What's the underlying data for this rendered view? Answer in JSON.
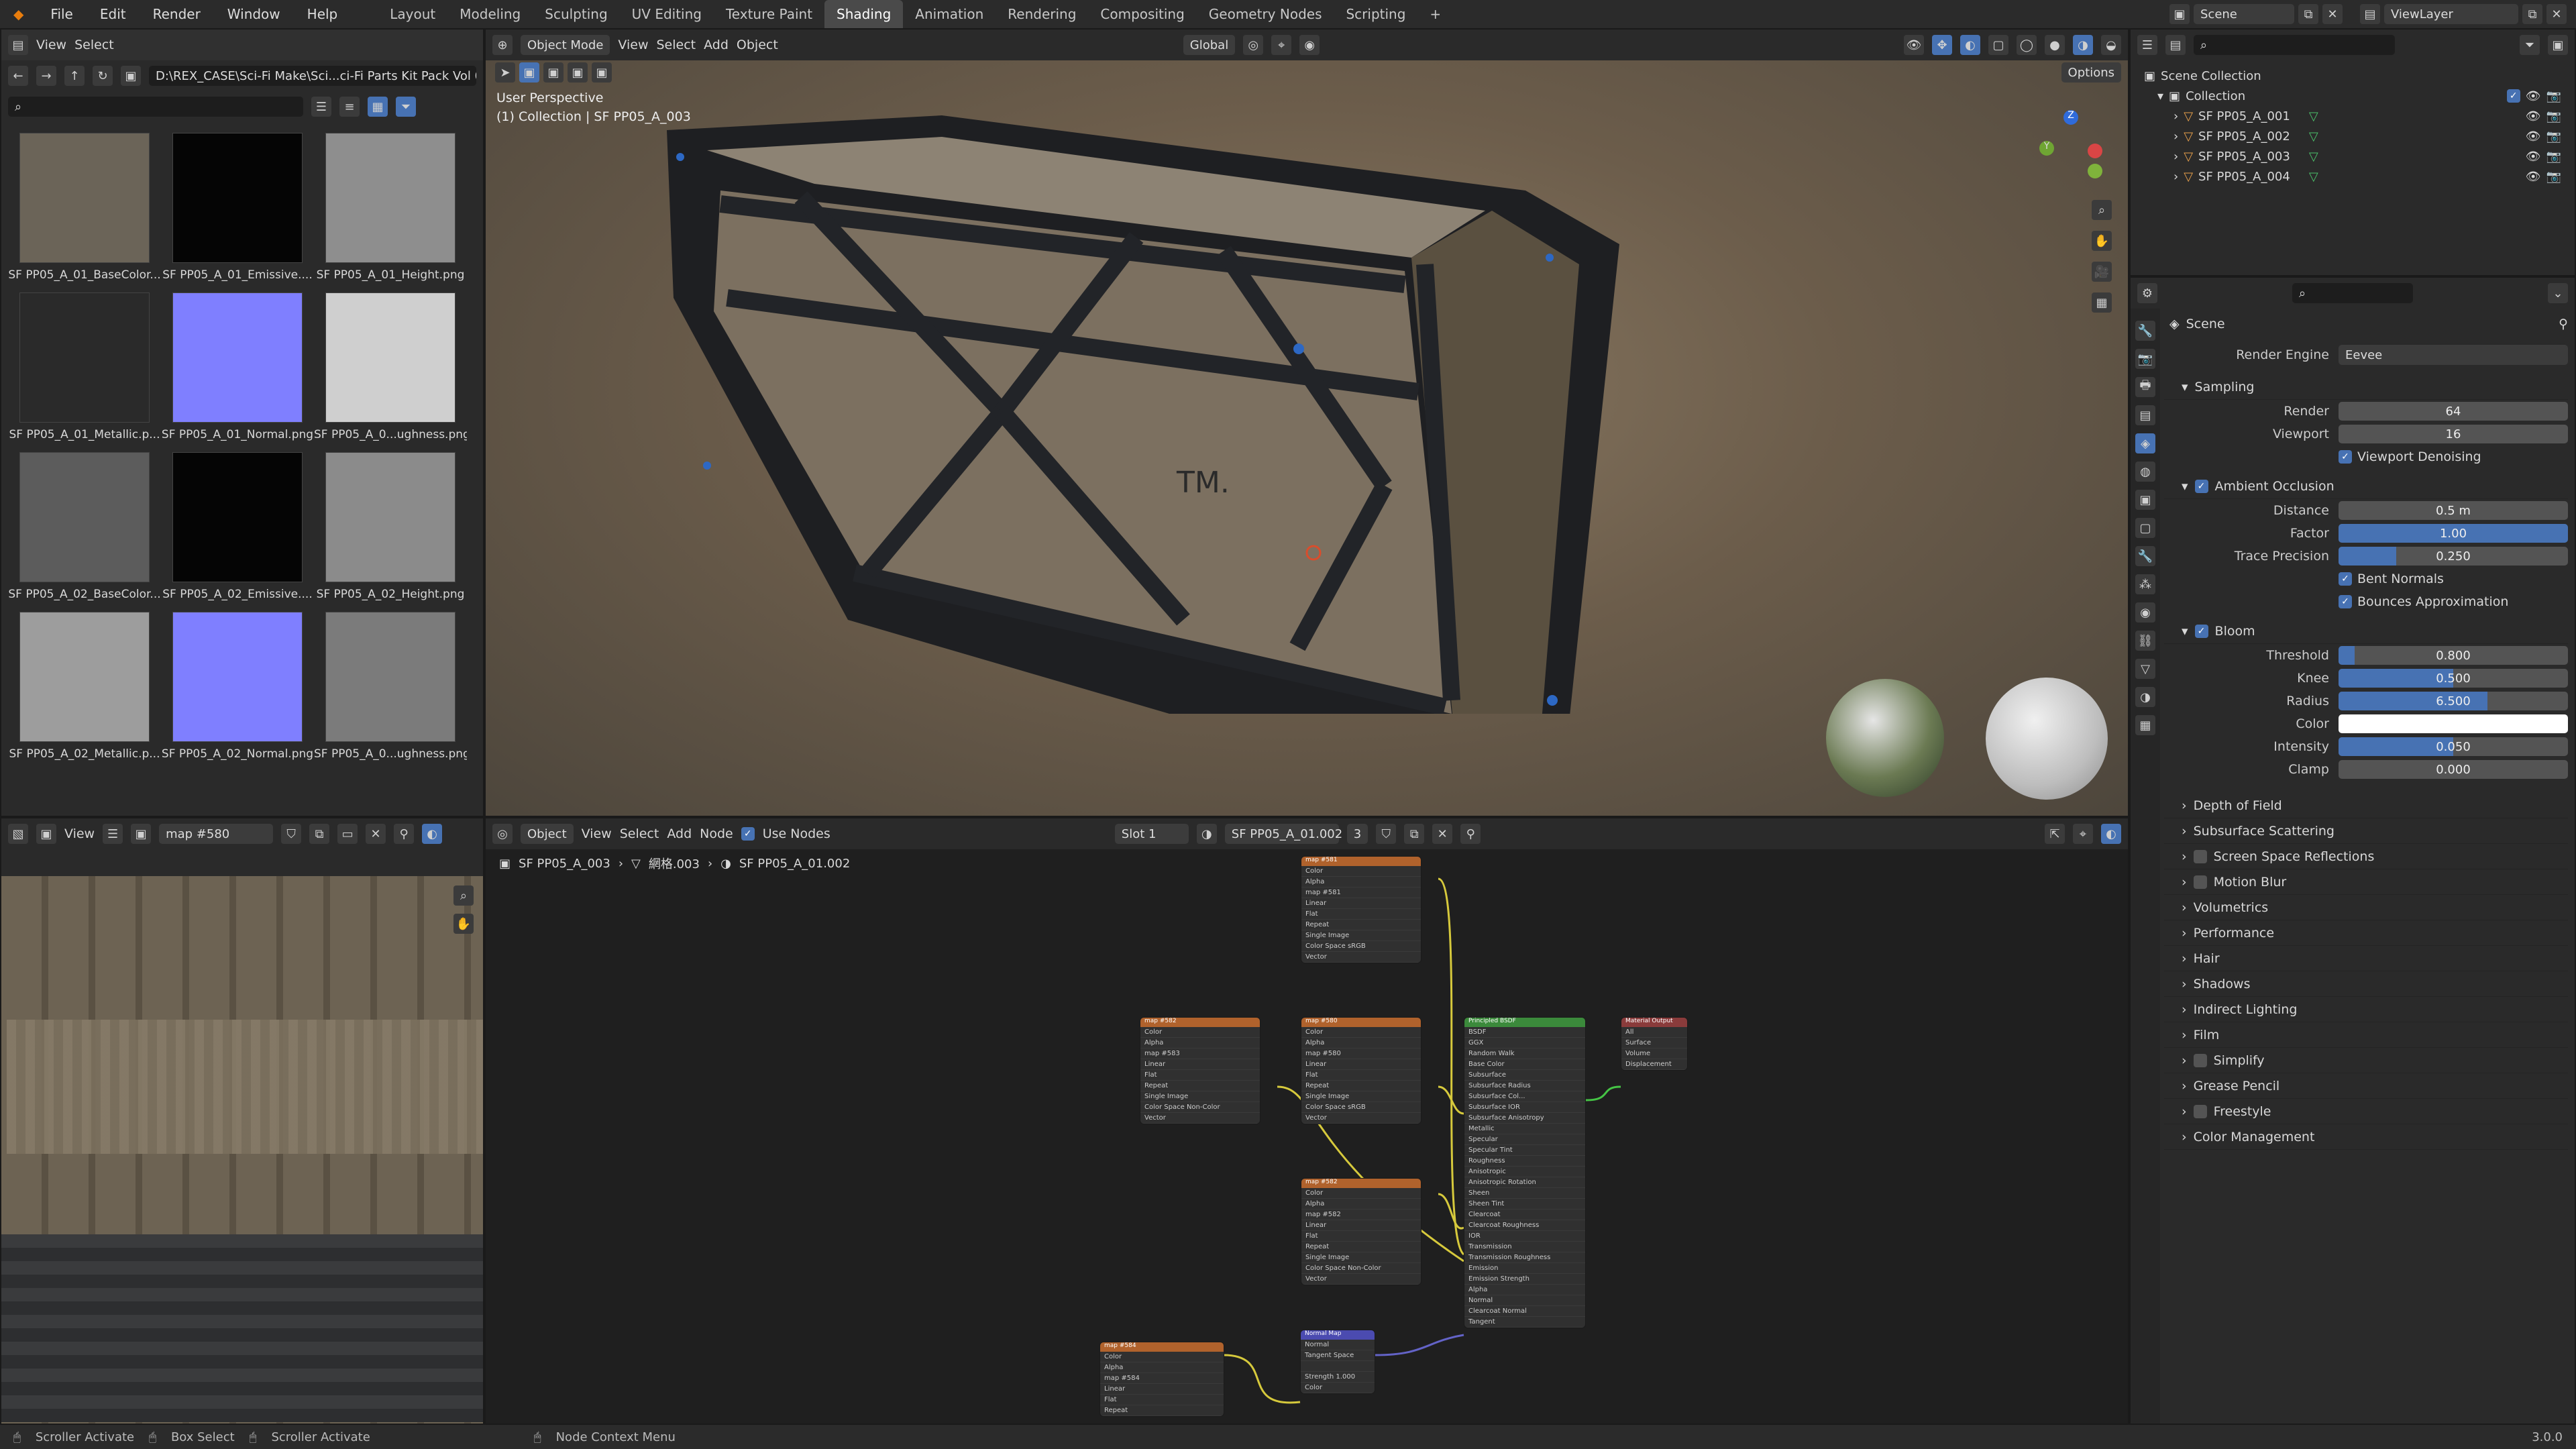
{
  "menu": [
    "File",
    "Edit",
    "Render",
    "Window",
    "Help"
  ],
  "workspaces": [
    "Layout",
    "Modeling",
    "Sculpting",
    "UV Editing",
    "Texture Paint",
    "Shading",
    "Animation",
    "Rendering",
    "Compositing",
    "Geometry Nodes",
    "Scripting"
  ],
  "active_workspace": "Shading",
  "scene_name": "Scene",
  "view_layer": "ViewLayer",
  "file_browser": {
    "menus": [
      "View",
      "Select"
    ],
    "path": "D:\\REX_CASE\\Sci-Fi Make\\Sci...ci-Fi Parts Kit Pack Vol 05_A\\",
    "thumbnails": [
      {
        "label": "SF PP05_A_01_BaseColor...",
        "color": "#6b6458"
      },
      {
        "label": "SF PP05_A_01_Emissive....",
        "color": "#050505"
      },
      {
        "label": "SF PP05_A_01_Height.png",
        "color": "#8e8e8e"
      },
      {
        "label": "SF PP05_A_01_Metallic.p...",
        "color": "#2a2a2a"
      },
      {
        "label": "SF PP05_A_01_Normal.png",
        "color": "#7f7fff"
      },
      {
        "label": "SF PP05_A_0...ughness.png",
        "color": "#cfcfcf"
      },
      {
        "label": "SF PP05_A_02_BaseColor...",
        "color": "#5c5c5c"
      },
      {
        "label": "SF PP05_A_02_Emissive....",
        "color": "#050505"
      },
      {
        "label": "SF PP05_A_02_Height.png",
        "color": "#8b8b8b"
      },
      {
        "label": "SF PP05_A_02_Metallic.p...",
        "color": "#9d9d9d"
      },
      {
        "label": "SF PP05_A_02_Normal.png",
        "color": "#7f7fff"
      },
      {
        "label": "SF PP05_A_0...ughness.png",
        "color": "#7b7b7b"
      }
    ]
  },
  "viewport": {
    "mode": "Object Mode",
    "menus": [
      "View",
      "Select",
      "Add",
      "Object"
    ],
    "transform": "Global",
    "options": "Options",
    "info_line1": "User Perspective",
    "info_line2": "(1) Collection | SF PP05_A_003",
    "crate_mark": "TM."
  },
  "image_editor": {
    "menu": "View",
    "image": "map #580"
  },
  "node_editor": {
    "object_mode": "Object",
    "menus": [
      "View",
      "Select",
      "Add",
      "Node"
    ],
    "use_nodes": "Use Nodes",
    "slot": "Slot 1",
    "material": "SF PP05_A_01.002",
    "users": "3",
    "breadcrumb": [
      "SF PP05_A_003",
      "網格.003",
      "SF PP05_A_01.002"
    ],
    "nodes": [
      {
        "title": "map #581",
        "rows": [
          "Color",
          "Alpha",
          "map #581",
          "Linear",
          "Flat",
          "Repeat",
          "Single Image",
          "Color Space  sRGB",
          "Vector"
        ],
        "color": "#b0622c"
      },
      {
        "title": "map #582",
        "rows": [
          "Color",
          "Alpha",
          "map #583",
          "Linear",
          "Flat",
          "Repeat",
          "Single Image",
          "Color Space  Non-Color",
          "Vector"
        ],
        "color": "#b0622c"
      },
      {
        "title": "map #580",
        "rows": [
          "Color",
          "Alpha",
          "map #580",
          "Linear",
          "Flat",
          "Repeat",
          "Single Image",
          "Color Space  sRGB",
          "Vector"
        ],
        "color": "#b0622c"
      },
      {
        "title": "map #582",
        "rows": [
          "Color",
          "Alpha",
          "map #582",
          "Linear",
          "Flat",
          "Repeat",
          "Single Image",
          "Color Space  Non-Color",
          "Vector"
        ],
        "color": "#b0622c"
      },
      {
        "title": "Principled BSDF",
        "rows": [
          "BSDF",
          "GGX",
          "Random Walk",
          "Base Color",
          "Subsurface",
          "Subsurface Radius",
          "Subsurface Col...",
          "Subsurface IOR",
          "Subsurface Anisotropy",
          "Metallic",
          "Specular",
          "Specular Tint",
          "Roughness",
          "Anisotropic",
          "Anisotropic Rotation",
          "Sheen",
          "Sheen Tint",
          "Clearcoat",
          "Clearcoat Roughness",
          "IOR",
          "Transmission",
          "Transmission Roughness",
          "Emission",
          "Emission Strength",
          "Alpha",
          "Normal",
          "Clearcoat Normal",
          "Tangent"
        ],
        "color": "#3b8a3b"
      },
      {
        "title": "Material Output",
        "rows": [
          "All",
          "Surface",
          "Volume",
          "Displacement"
        ],
        "color": "#8a3b3b"
      },
      {
        "title": "map #584",
        "rows": [
          "Color",
          "Alpha",
          "map #584",
          "Linear",
          "Flat",
          "Repeat"
        ],
        "color": "#b0622c"
      },
      {
        "title": "Normal Map",
        "rows": [
          "Normal",
          "Tangent Space",
          "",
          "Strength  1.000",
          "Color"
        ],
        "color": "#4b4bb0"
      }
    ]
  },
  "outliner": {
    "root": "Scene Collection",
    "collection": "Collection",
    "objects": [
      "SF PP05_A_001",
      "SF PP05_A_002",
      "SF PP05_A_003",
      "SF PP05_A_004"
    ]
  },
  "properties": {
    "context": "Scene",
    "render_engine_label": "Render Engine",
    "render_engine": "Eevee",
    "sampling": {
      "title": "Sampling",
      "render_label": "Render",
      "render": "64",
      "viewport_label": "Viewport",
      "viewport": "16",
      "denoise": "Viewport Denoising"
    },
    "ao": {
      "title": "Ambient Occlusion",
      "distance_label": "Distance",
      "distance": "0.5 m",
      "factor_label": "Factor",
      "factor": "1.00",
      "factor_fill": 1.0,
      "trace_label": "Trace Precision",
      "trace": "0.250",
      "trace_fill": 0.25,
      "bent": "Bent Normals",
      "bounces": "Bounces Approximation"
    },
    "bloom": {
      "title": "Bloom",
      "threshold_label": "Threshold",
      "threshold": "0.800",
      "threshold_fill": 0.07,
      "knee_label": "Knee",
      "knee": "0.500",
      "knee_fill": 0.5,
      "radius_label": "Radius",
      "radius": "6.500",
      "radius_fill": 0.65,
      "color_label": "Color",
      "color": "#ffffff",
      "intensity_label": "Intensity",
      "intensity": "0.050",
      "intensity_fill": 0.5,
      "clamp_label": "Clamp",
      "clamp": "0.000"
    },
    "collapsed": [
      {
        "label": "Depth of Field",
        "checkbox": false
      },
      {
        "label": "Subsurface Scattering",
        "checkbox": false
      },
      {
        "label": "Screen Space Reflections",
        "checkbox": true
      },
      {
        "label": "Motion Blur",
        "checkbox": true
      },
      {
        "label": "Volumetrics",
        "checkbox": false
      },
      {
        "label": "Performance",
        "checkbox": false
      },
      {
        "label": "Hair",
        "checkbox": false
      },
      {
        "label": "Shadows",
        "checkbox": false
      },
      {
        "label": "Indirect Lighting",
        "checkbox": false
      },
      {
        "label": "Film",
        "checkbox": false
      },
      {
        "label": "Simplify",
        "checkbox": true
      },
      {
        "label": "Grease Pencil",
        "checkbox": false
      },
      {
        "label": "Freestyle",
        "checkbox": true
      },
      {
        "label": "Color Management",
        "checkbox": false
      }
    ]
  },
  "status": {
    "a": "Scroller Activate",
    "b": "Box Select",
    "c": "Scroller Activate",
    "d": "Node Context Menu",
    "version": "3.0.0"
  }
}
